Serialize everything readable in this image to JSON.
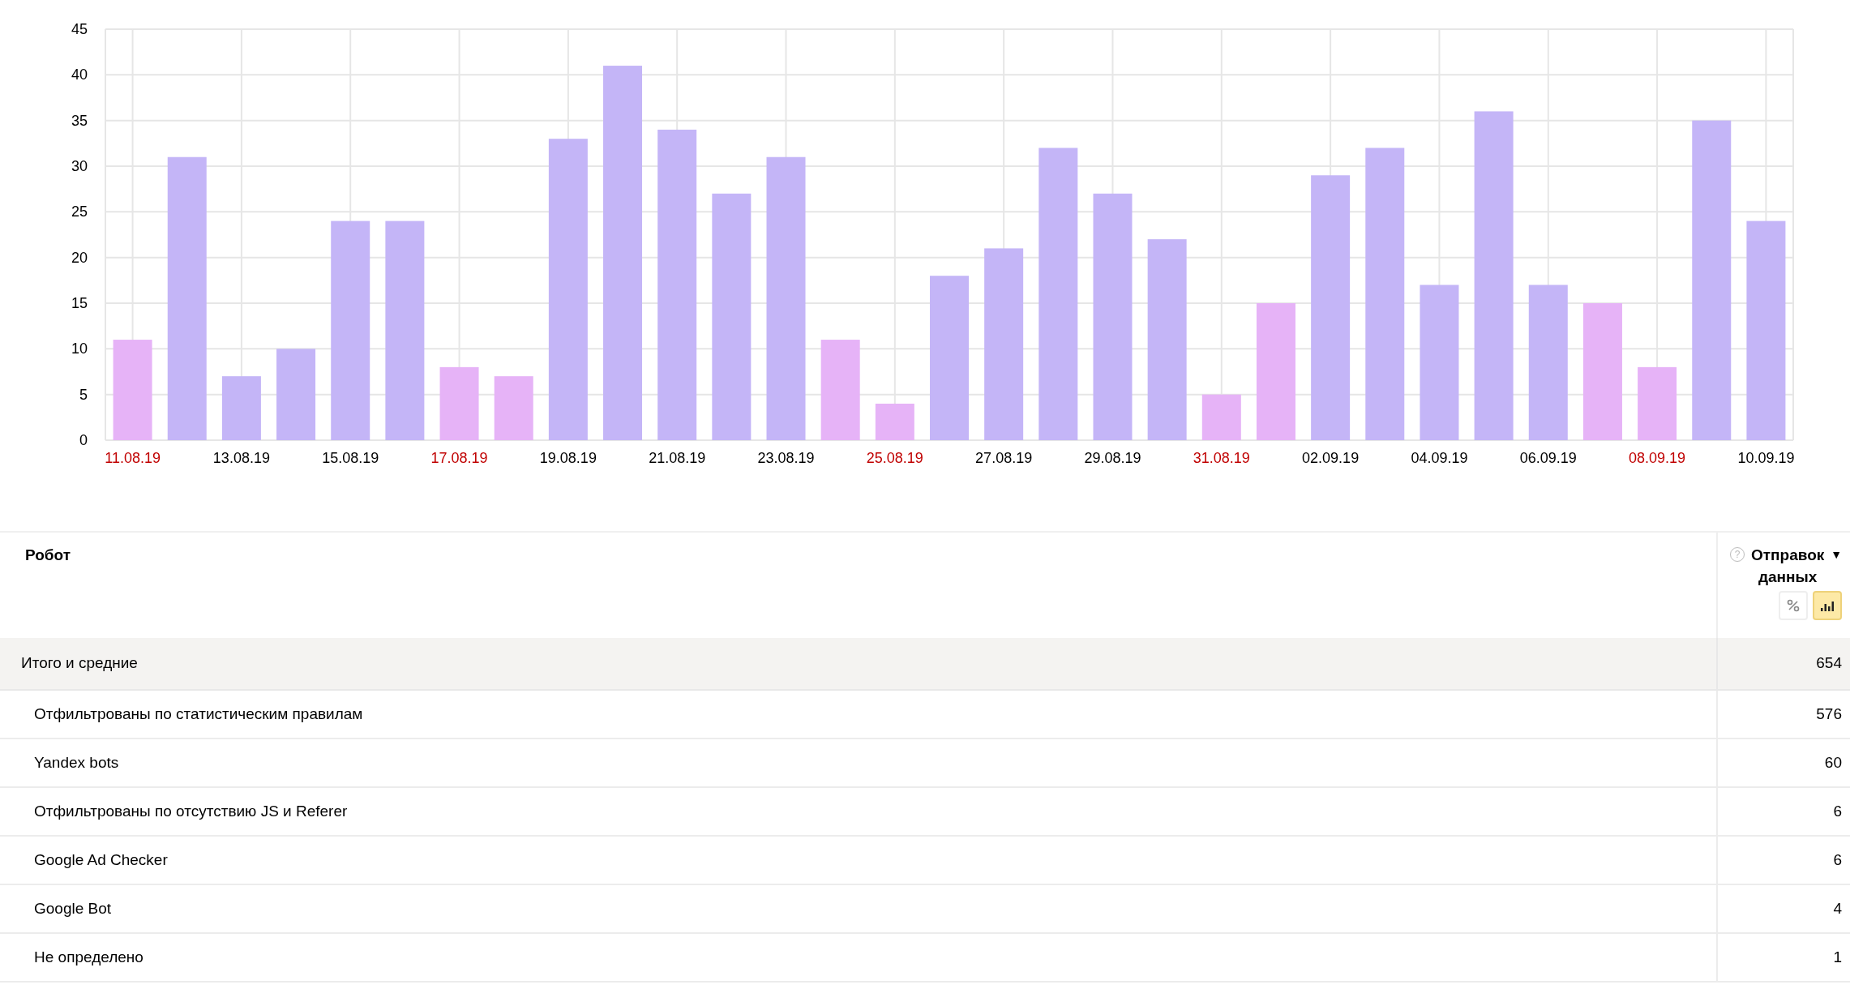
{
  "chart": {
    "chart_data": {
      "type": "bar",
      "stacked": true,
      "grid": true,
      "series": [
        {
          "color": "#c4b5f7",
          "values": [
            null,
            31,
            7,
            10,
            24,
            24,
            null,
            null,
            33,
            41,
            34,
            27,
            31,
            null,
            null,
            18,
            21,
            32,
            27,
            22,
            null,
            null,
            29,
            32,
            17,
            36,
            17,
            null,
            null,
            35,
            24
          ]
        },
        {
          "color": "#e6b3f7",
          "values": [
            11,
            null,
            null,
            null,
            null,
            null,
            8,
            7,
            null,
            null,
            null,
            null,
            null,
            11,
            4,
            null,
            null,
            null,
            null,
            null,
            5,
            15,
            null,
            null,
            null,
            null,
            null,
            15,
            8,
            null,
            null
          ]
        }
      ],
      "ylim": [
        0,
        45
      ],
      "yticks": [
        0,
        5,
        10,
        15,
        20,
        25,
        30,
        35,
        40,
        45
      ],
      "categories": [
        "11.08.19",
        null,
        "13.08.19",
        null,
        "15.08.19",
        null,
        "17.08.19",
        null,
        "19.08.19",
        null,
        "21.08.19",
        null,
        "23.08.19",
        null,
        "25.08.19",
        null,
        "27.08.19",
        null,
        "29.08.19",
        null,
        "31.08.19",
        null,
        "02.09.19",
        null,
        "04.09.19",
        null,
        "06.09.19",
        null,
        "08.09.19",
        null,
        "10.09.19"
      ]
    },
    "label_weekend": [
      true,
      false,
      false,
      true,
      false,
      false,
      false,
      true,
      false,
      false,
      true,
      false,
      false,
      false,
      true,
      false
    ]
  },
  "table": {
    "columns": [
      {
        "label": "Робот"
      },
      {
        "label": "Отправок данных",
        "help_mark": "?",
        "sort_mark": "▼",
        "toggles": [
          {
            "kind": "percent",
            "selected": false
          },
          {
            "kind": "bars",
            "selected": true
          }
        ]
      }
    ],
    "total": {
      "label": "Итого и средние",
      "value": "654"
    },
    "rows": [
      {
        "label": "Отфильтрованы по статистическим правилам",
        "value": "576"
      },
      {
        "label": "Yandex bots",
        "value": "60"
      },
      {
        "label": "Отфильтрованы по отсутствию JS и Referer",
        "value": "6"
      },
      {
        "label": "Google Ad Checker",
        "value": "6"
      },
      {
        "label": "Google Bot",
        "value": "4"
      },
      {
        "label": "Не определено",
        "value": "1"
      }
    ]
  }
}
